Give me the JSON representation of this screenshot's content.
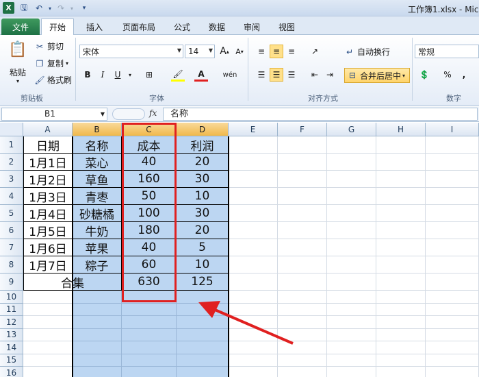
{
  "titlebar": {
    "title": "工作簿1.xlsx - Mic"
  },
  "tabs": [
    "文件",
    "开始",
    "插入",
    "页面布局",
    "公式",
    "数据",
    "审阅",
    "视图"
  ],
  "ribbon": {
    "clipboard": {
      "paste": "粘贴",
      "cut": "剪切",
      "copy": "复制",
      "format_painter": "格式刷",
      "label": "剪贴板"
    },
    "font": {
      "name": "宋体",
      "size": "14",
      "bold": "B",
      "italic": "I",
      "underline": "U",
      "label": "字体"
    },
    "alignment": {
      "wrap": "自动换行",
      "merge": "合并后居中",
      "label": "对齐方式"
    },
    "number": {
      "format": "常规",
      "percent": "%",
      "comma": ",",
      "label": "数字"
    }
  },
  "formula_bar": {
    "name_box": "B1",
    "fx": "fx",
    "value": "名称"
  },
  "columns": [
    "A",
    "B",
    "C",
    "D",
    "E",
    "F",
    "G",
    "H",
    "I"
  ],
  "rows": [
    "1",
    "2",
    "3",
    "4",
    "5",
    "6",
    "7",
    "8",
    "9",
    "10",
    "11",
    "12",
    "13",
    "14",
    "15",
    "16"
  ],
  "table": {
    "header": [
      "日期",
      "名称",
      "成本",
      "利润"
    ],
    "rows": [
      [
        "1月1日",
        "菜心",
        "40",
        "20"
      ],
      [
        "1月2日",
        "草鱼",
        "160",
        "30"
      ],
      [
        "1月3日",
        "青枣",
        "50",
        "10"
      ],
      [
        "1月4日",
        "砂糖橘",
        "100",
        "30"
      ],
      [
        "1月5日",
        "牛奶",
        "180",
        "20"
      ],
      [
        "1月6日",
        "苹果",
        "40",
        "5"
      ],
      [
        "1月7日",
        "粽子",
        "60",
        "10"
      ]
    ],
    "total": {
      "label": "合集",
      "cost": "630",
      "profit": "125"
    }
  },
  "colors": {
    "selection": "#bcd6f2",
    "highlight_box": "#e02020",
    "excel_green": "#1e7145"
  }
}
